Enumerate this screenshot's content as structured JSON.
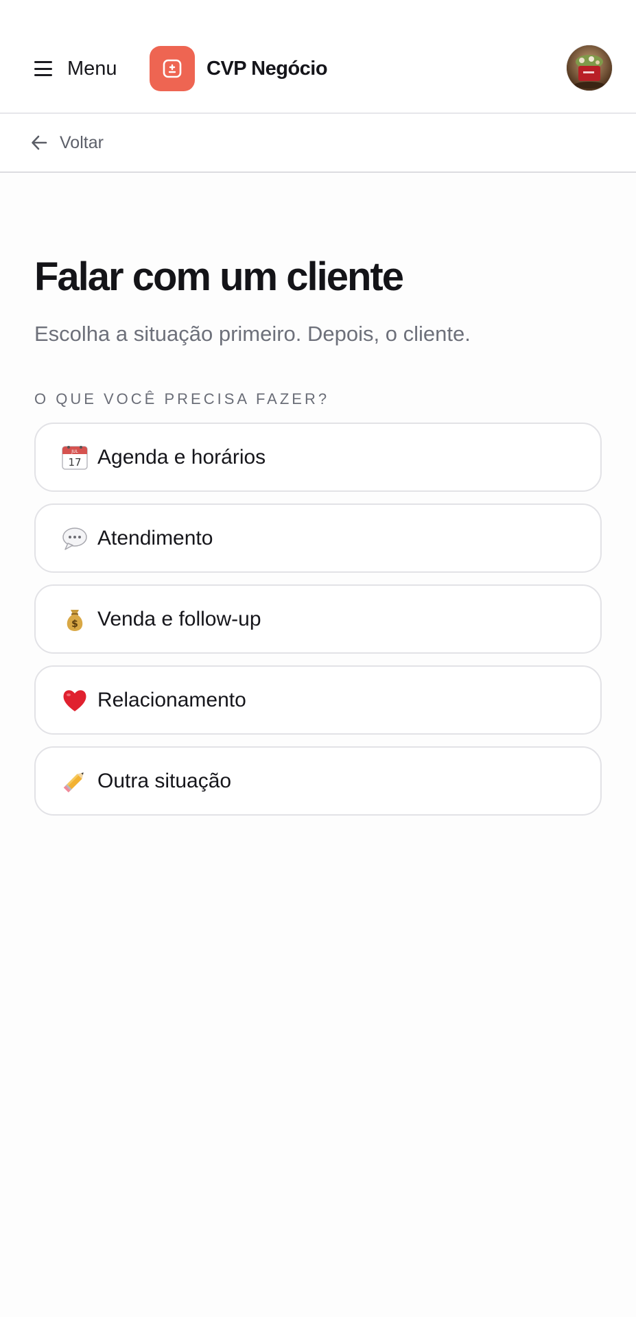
{
  "header": {
    "menu_label": "Menu",
    "brand_name": "CVP Negócio",
    "brand_color": "#ee6552",
    "avatar_icon": "profile-photo"
  },
  "nav": {
    "back_label": "Voltar"
  },
  "main": {
    "title": "Falar com um cliente",
    "subtitle": "Escolha a situação primeiro. Depois, o cliente.",
    "section_label": "O QUE VOCÊ PRECISA FAZER?",
    "options": [
      {
        "label": "Agenda e horários",
        "icon": "calendar-icon"
      },
      {
        "label": "Atendimento",
        "icon": "speech-bubble-icon"
      },
      {
        "label": "Venda e follow-up",
        "icon": "money-bag-icon"
      },
      {
        "label": "Relacionamento",
        "icon": "red-heart-icon"
      },
      {
        "label": "Outra situação",
        "icon": "pencil-icon"
      }
    ]
  }
}
